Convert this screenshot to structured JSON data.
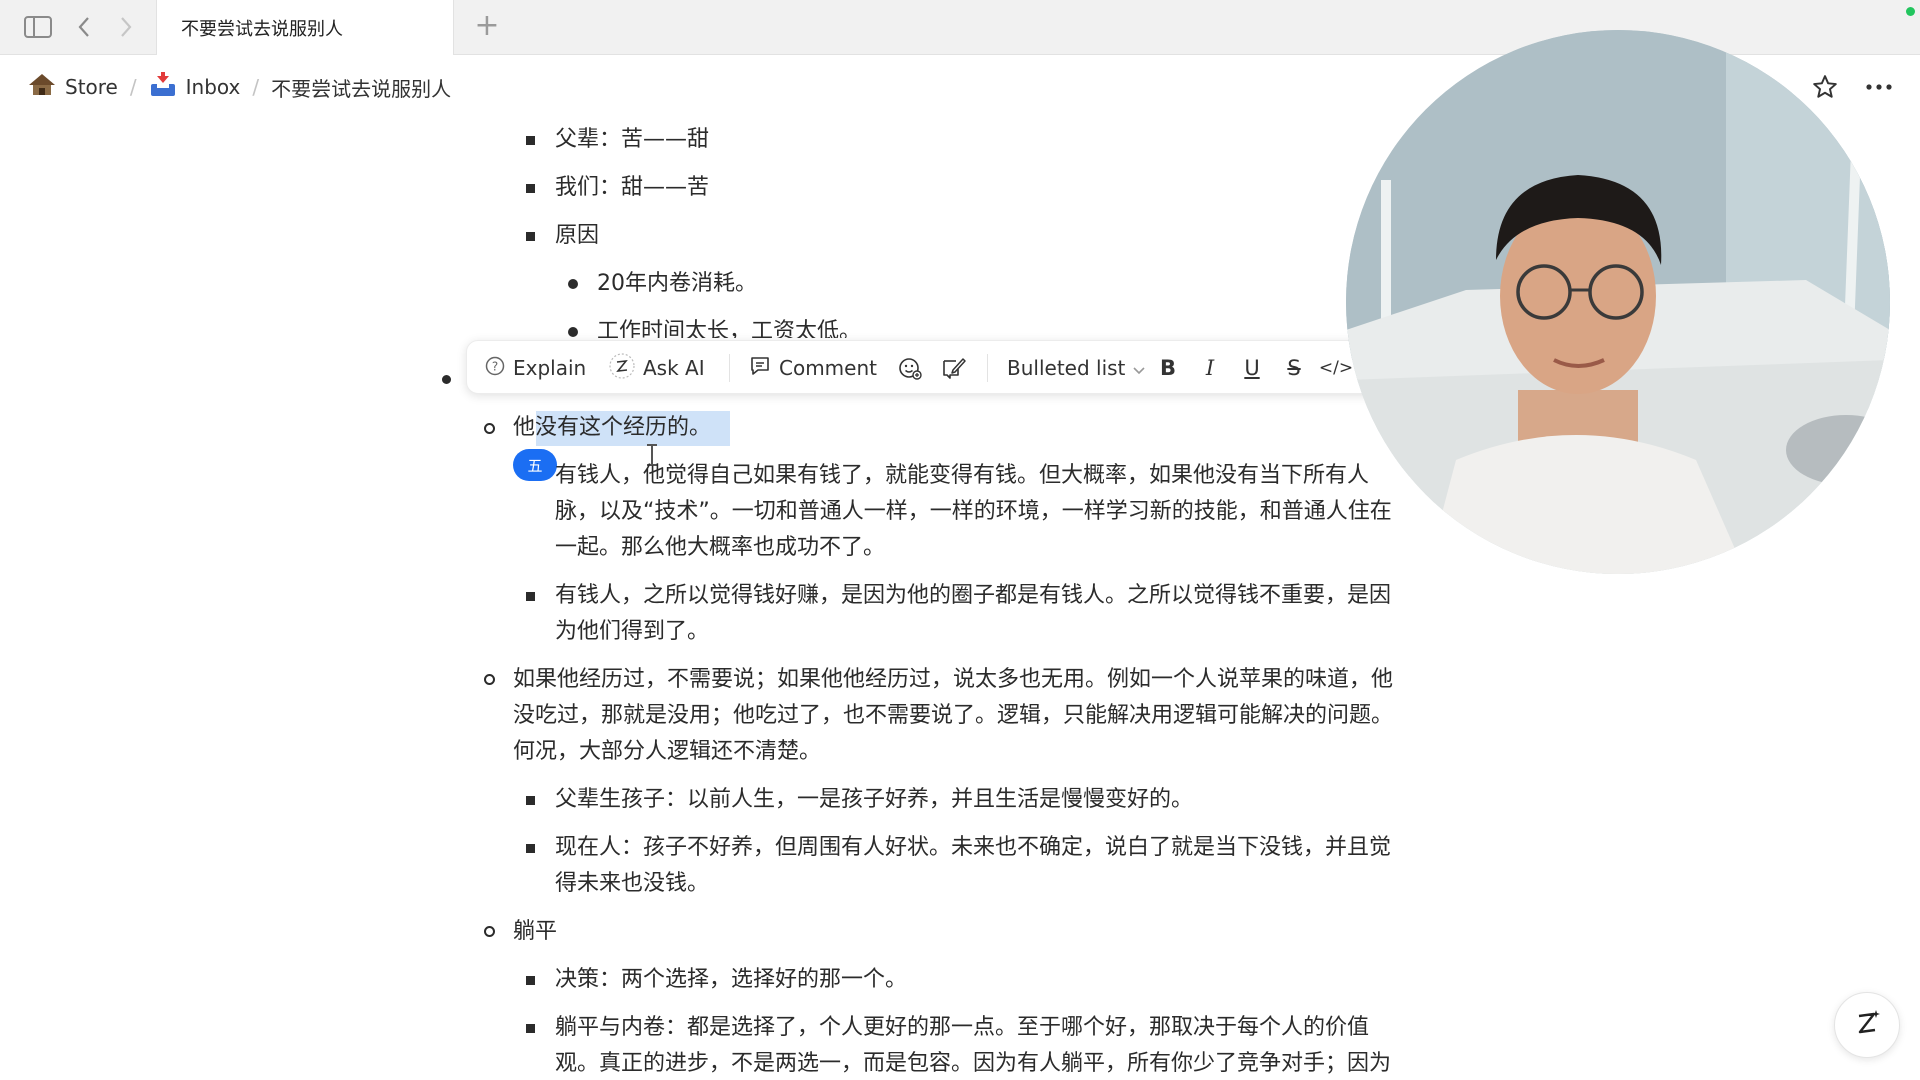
{
  "tab": {
    "title": "不要尝试去说服别人",
    "new_tab": "+"
  },
  "breadcrumb": {
    "items": [
      {
        "label": "Store",
        "icon": "hut-icon"
      },
      {
        "label": "Inbox",
        "icon": "inbox-tray-icon"
      },
      {
        "label": "不要尝试去说服别人"
      }
    ],
    "separator": "/"
  },
  "toolbar": {
    "explain": "Explain",
    "ask_ai": "Ask AI",
    "comment": "Comment",
    "block_type": "Bulleted list",
    "bold": "B",
    "italic": "I",
    "underline": "U",
    "strike": "S",
    "code": "</>"
  },
  "ime_badge": "五",
  "content": {
    "l1": "父辈：苦——甜",
    "l2": "我们：甜——苦",
    "l3": "原因",
    "l4": "20年内卷消耗。",
    "l5": "工作时间太长，工资太低。",
    "l6": "他没有这个经历的。",
    "l7a": "有钱人，他觉得自己如果有钱了，就能变得有钱。但大概率，如果他没有当下所有人",
    "l7b": "脉，以及“技术”。一切和普通人一样，一样的环境，一样学习新的技能，和普通人住在",
    "l7c": "一起。那么他大概率也成功不了。",
    "l8a": "有钱人，之所以觉得钱好赚，是因为他的圈子都是有钱人。之所以觉得钱不重要，是因",
    "l8b": "为他们得到了。",
    "l9a": "如果他经历过，不需要说；如果他他经历过，说太多也无用。例如一个人说苹果的味道，他",
    "l9b": "没吃过，那就是没用；他吃过了，也不需要说了。逻辑，只能解决用逻辑可能解决的问题。",
    "l9c": "何况，大部分人逻辑还不清楚。",
    "l10": "父辈生孩子：以前人生，一是孩子好养，并且生活是慢慢变好的。",
    "l11a": "现在人：孩子不好养，但周围有人好状。未来也不确定，说白了就是当下没钱，并且觉",
    "l11b": "得未来也没钱。",
    "l12": "躺平",
    "l13": "决策：两个选择，选择好的那一个。",
    "l14a": "躺平与内卷：都是选择了，个人更好的那一点。至于哪个好，那取决于每个人的价值",
    "l14b": "观。真正的进步，不是两选一，而是包容。因为有人躺平，所有你少了竞争对手；因为"
  },
  "colors": {
    "accent": "#1b6ef3",
    "selection": "#cfe2f8",
    "status_dot": "#22c55e"
  }
}
